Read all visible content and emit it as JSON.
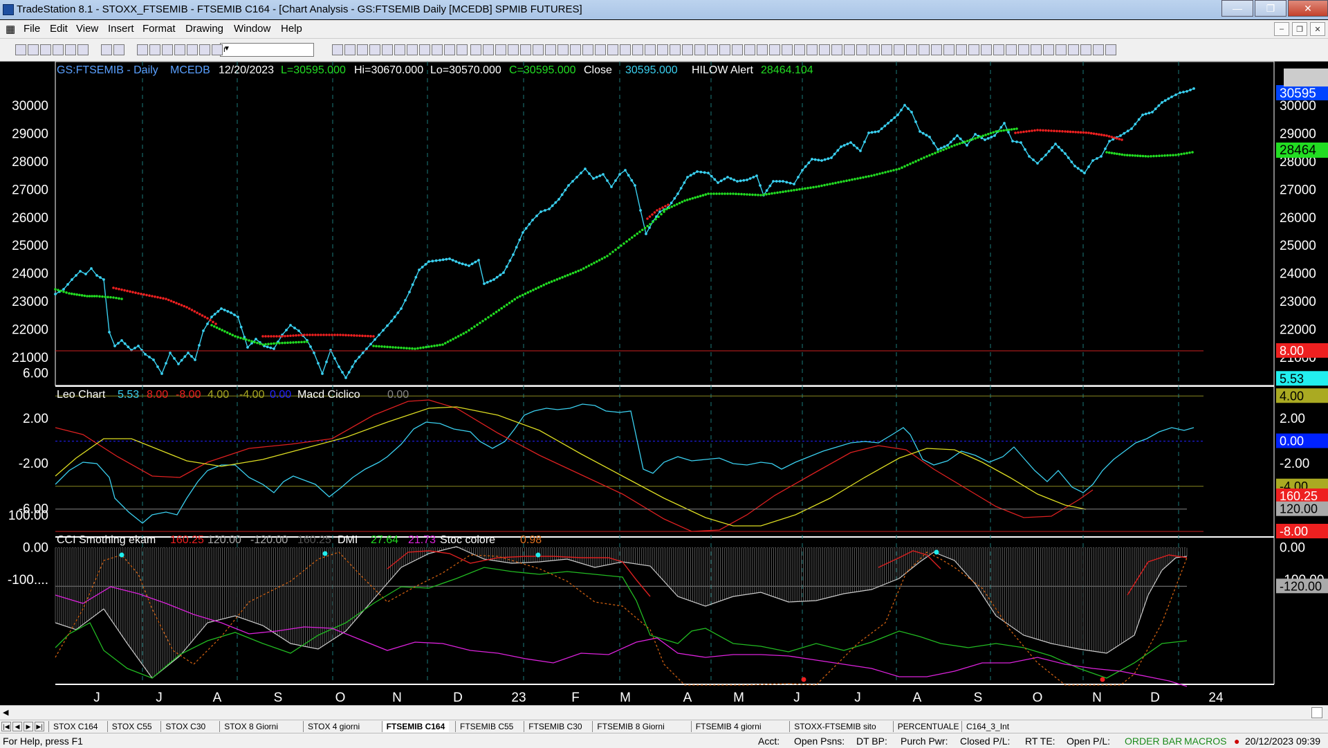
{
  "window": {
    "title": "TradeStation 8.1 - STOXX_FTSEMIB - FTSEMIB C164 - [Chart Analysis - GS:FTSEMIB  Daily  [MCEDB] SPMIB FUTURES]"
  },
  "menu": [
    "File",
    "Edit",
    "View",
    "Insert",
    "Format",
    "Drawing",
    "Window",
    "Help"
  ],
  "toolbar": {
    "symbol_value": "r"
  },
  "price_panel": {
    "symbol": "GS:FTSEMIB - Daily",
    "exchange": "MCEDB",
    "date": "12/20/2023",
    "last": "L=30595.000",
    "high": "Hi=30670.000",
    "low": "Lo=30570.000",
    "close_eq": "C=30595.000",
    "close_label": "Close",
    "close_val": "30595.000",
    "hilow_label": "HILOW Alert",
    "hilow_val": "28464.104",
    "axis_ticks": [
      "30000",
      "29000",
      "28000",
      "27000",
      "26000",
      "25000",
      "24000",
      "23000",
      "22000",
      "21000"
    ],
    "right_ticks": [
      "30000",
      "29000",
      "28000",
      "27000",
      "26000",
      "25000",
      "24000",
      "23000",
      "22000",
      "21000"
    ],
    "badge_price": "30595",
    "badge_hilow": "28464"
  },
  "leo_panel": {
    "name": "Leo Chart",
    "v1": "5.53",
    "v2": "8.00",
    "v3": "-8.00",
    "v4": "4.00",
    "v5": "-4.00",
    "v6": "0.00",
    "macd_label": "Macd Ciclico",
    "macd_val": "0.00",
    "axis_ticks": [
      "6.00",
      "2.00",
      "-2.00",
      "-6.00"
    ],
    "right_ticks": [
      "2.00",
      "-2.00",
      "-6.00"
    ],
    "badges": {
      "b8": "8.00",
      "b553": "5.53",
      "b4": "4.00",
      "b0": "0.00",
      "bm4": "-4.00",
      "bm8": "-8.00"
    }
  },
  "cci_panel": {
    "name": "CCI Smothing ekam",
    "v1": "160.25",
    "v2": "120.00",
    "v3": "-120.00",
    "v4": "160.25",
    "dmi_label": "DMI",
    "dmi_plus": "27.64",
    "dmi_minus": "21.73",
    "stoc_label": "Stoc colore",
    "stoc_val": "0.98",
    "axis_ticks": [
      "100.00",
      "0.00",
      "-100...."
    ],
    "right_ticks": [
      "0.00",
      "-100.00"
    ],
    "badges": {
      "b160": "160.25",
      "b120": "120.00",
      "bm120": "-120.00"
    }
  },
  "time_axis": [
    "J",
    "J",
    "A",
    "S",
    "O",
    "N",
    "D",
    "23",
    "F",
    "M",
    "A",
    "M",
    "J",
    "J",
    "A",
    "S",
    "O",
    "N",
    "D",
    "24"
  ],
  "tabs": [
    "STOX C164",
    "STOX C55",
    "STOX  C30",
    "STOX  8 Giorni",
    "STOX 4 giorni",
    "FTSEMIB C164",
    "FTSEMIB C55",
    "FTSEMIB C30",
    "FTSEMIB  8 Giorni",
    "FTSEMIB  4 giorni",
    "STOXX-FTSEMIB sito",
    "PERCENTUALE",
    "C164_3_Int"
  ],
  "status": {
    "help": "For Help, press F1",
    "acct": "Acct:",
    "open_psns": "Open Psns:",
    "dt_bp": "DT BP:",
    "purch_pwr": "Purch Pwr:",
    "closed_pl": "Closed P/L:",
    "rt_te": "RT TE:",
    "open_pl": "Open P/L:",
    "order_bar": "ORDER BAR",
    "macros": "MACROS",
    "datetime": "20/12/2023 09:39"
  },
  "colors": {
    "price": "#3ad0f0",
    "hilow_up": "#22dd22",
    "hilow_down": "#ee2020",
    "yellow": "#dddd22",
    "magenta": "#dd22dd",
    "green": "#22bb22"
  }
}
